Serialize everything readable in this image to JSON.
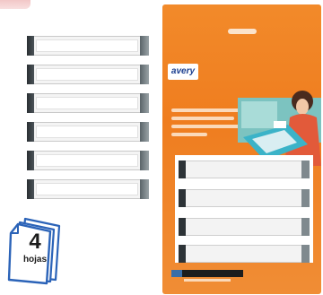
{
  "badge": {
    "number": "4",
    "word": "hojas"
  },
  "package": {
    "brand": "avery"
  },
  "colors": {
    "package_orange": "#ef7d1f",
    "label_tab_dark": "#2a2f33",
    "label_tab_gray": "#8f999d",
    "badge_blue": "#2b63b8"
  },
  "label_sheet": {
    "strip_count": 6
  }
}
